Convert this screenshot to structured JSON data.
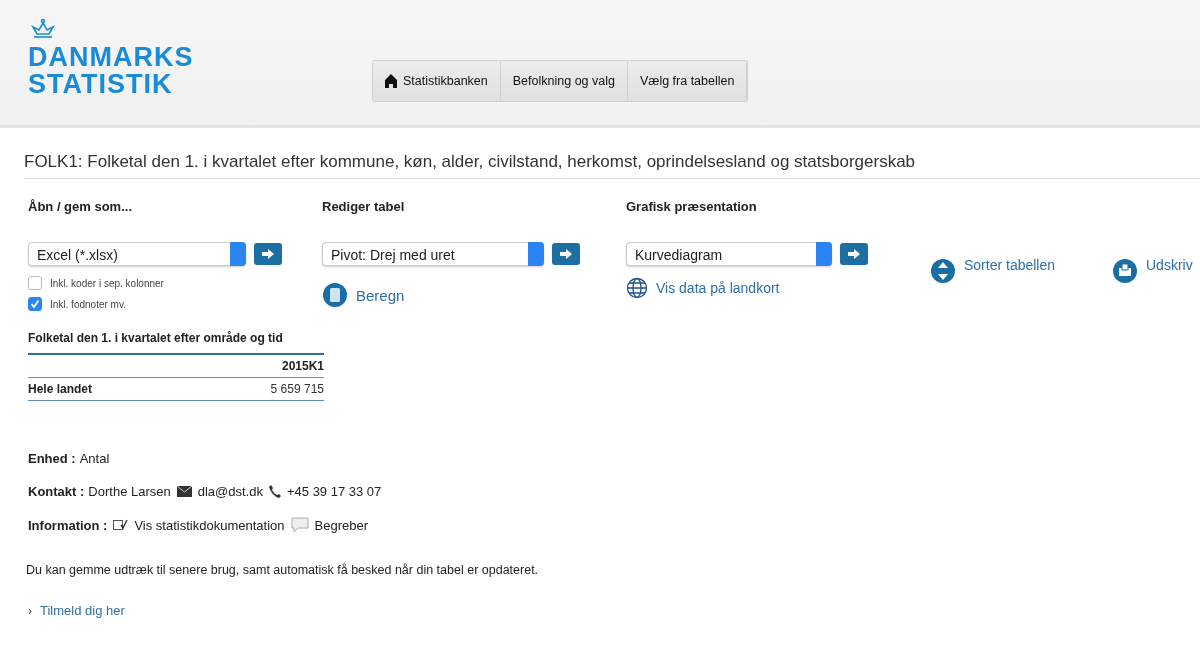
{
  "logo": {
    "line1": "DANMARKS",
    "line2": "STATISTIK"
  },
  "breadcrumb": [
    {
      "label": "Statistikbanken",
      "kind": "home"
    },
    {
      "label": "Befolkning og valg",
      "kind": "plain"
    },
    {
      "label": "Vælg fra tabellen",
      "kind": "plain"
    }
  ],
  "title": "FOLK1: Folketal den 1. i kvartalet efter kommune, køn, alder, civilstand, herkomst, oprindelsesland og statsborgerskab",
  "open_save": {
    "heading": "Åbn / gem som...",
    "select": "Excel (*.xlsx)",
    "options": [
      {
        "label": "Inkl. koder i sep. kolonner",
        "checked": false
      },
      {
        "label": "Inkl. fodnoter mv.",
        "checked": true
      }
    ]
  },
  "edit": {
    "heading": "Rediger tabel",
    "select": "Pivot: Drej med uret",
    "link": "Beregn"
  },
  "graphic": {
    "heading": "Grafisk præsentation",
    "select": "Kurvediagram",
    "link": "Vis data på landkort"
  },
  "actions": [
    {
      "label": "Sorter tabellen",
      "kind": "sort"
    },
    {
      "label": "Udskriv",
      "kind": "print"
    }
  ],
  "table": {
    "caption": "Folketal den 1. i kvartalet efter område og tid",
    "column": "2015K1",
    "rows": [
      {
        "label": "Hele landet",
        "value": "5 659 715"
      }
    ]
  },
  "info": {
    "unit_label": "Enhed :",
    "unit": "Antal",
    "contact_label": "Kontakt :",
    "contact_name": "Dorthe Larsen",
    "email": "dla@dst.dk",
    "phone": "+45 39 17 33 07",
    "information_label": "Information :",
    "doc_link": "Vis statistikdokumentation",
    "concepts_link": "Begreber"
  },
  "note": "Du kan gemme udtræk til senere brug, samt automatisk få besked når din tabel er opdateret.",
  "signup": {
    "marker": "›",
    "link": "Tilmeld dig her"
  }
}
